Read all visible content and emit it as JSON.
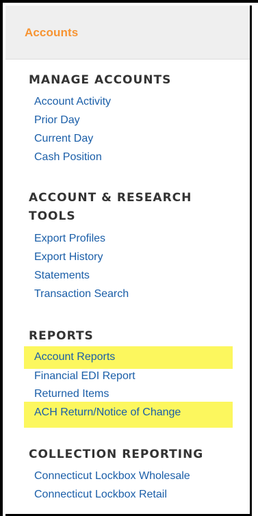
{
  "panel": {
    "title": "Accounts"
  },
  "sections": {
    "manage_accounts": {
      "heading": "MANAGE ACCOUNTS",
      "links": [
        "Account Activity",
        "Prior Day",
        "Current Day",
        "Cash Position"
      ]
    },
    "research_tools": {
      "heading": "ACCOUNT & RESEARCH TOOLS",
      "links": [
        "Export Profiles",
        "Export History",
        "Statements",
        "Transaction Search"
      ]
    },
    "reports": {
      "heading": "REPORTS",
      "links": [
        "Account Reports",
        "Financial EDI Report",
        "Returned Items",
        "ACH Return/Notice of Change"
      ]
    },
    "collection_reporting": {
      "heading": "COLLECTION REPORTING",
      "links": [
        "Connecticut Lockbox Wholesale",
        "Connecticut Lockbox Retail"
      ]
    }
  },
  "colors": {
    "title": "#f79432",
    "link": "#1a5ea8",
    "heading": "#333333",
    "highlight": "#fcf75e",
    "header_bg": "#efefef"
  }
}
